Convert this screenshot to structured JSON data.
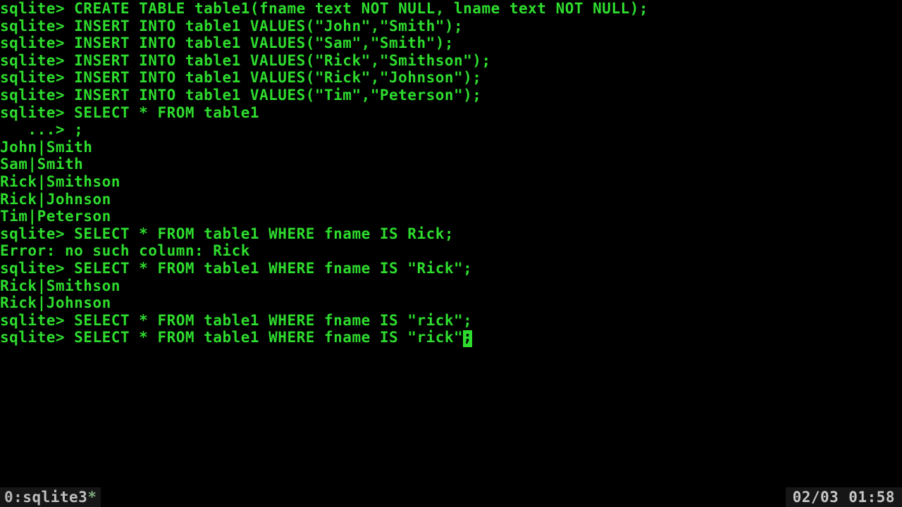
{
  "prompt": "sqlite> ",
  "cont_prompt": "   ...> ",
  "lines": {
    "l0": "CREATE TABLE table1(fname text NOT NULL, lname text NOT NULL);",
    "l1": "INSERT INTO table1 VALUES(\"John\",\"Smith\");",
    "l2": "INSERT INTO table1 VALUES(\"Sam\",\"Smith\");",
    "l3": "INSERT INTO table1 VALUES(\"Rick\",\"Smithson\");",
    "l4": "INSERT INTO table1 VALUES(\"Rick\",\"Johnson\");",
    "l5": "INSERT INTO table1 VALUES(\"Tim\",\"Peterson\");",
    "l6": "SELECT * FROM table1",
    "l7": ";",
    "l8": "John|Smith",
    "l9": "Sam|Smith",
    "l10": "Rick|Smithson",
    "l11": "Rick|Johnson",
    "l12": "Tim|Peterson",
    "l13": "SELECT * FROM table1 WHERE fname IS Rick;",
    "l14": "Error: no such column: Rick",
    "l15": "SELECT * FROM table1 WHERE fname IS \"Rick\";",
    "l16": "Rick|Smithson",
    "l17": "Rick|Johnson",
    "l18": "SELECT * FROM table1 WHERE fname IS \"rick\";",
    "l19": "SELECT * FROM table1 WHERE fname IS \"rick\""
  },
  "status": {
    "left_prefix": " 0:",
    "left_name": "sqlite3",
    "left_marker": "*",
    "right_counter": "02/03",
    "right_time": "01:58"
  }
}
